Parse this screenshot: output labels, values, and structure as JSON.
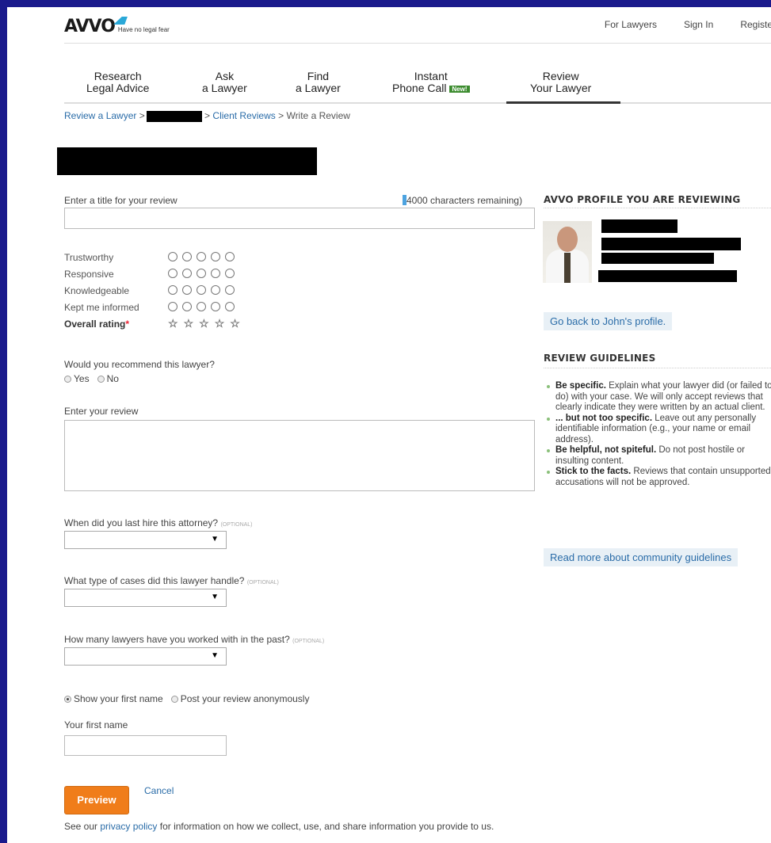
{
  "header": {
    "logo_text": "AVVO",
    "tagline": "Have no legal fear",
    "links": [
      "For Lawyers",
      "Sign In",
      "Register"
    ]
  },
  "nav": {
    "items": [
      {
        "line1": "Research",
        "line2": "Legal Advice"
      },
      {
        "line1": "Ask",
        "line2": "a Lawyer"
      },
      {
        "line1": "Find",
        "line2": "a Lawyer"
      },
      {
        "line1": "Instant",
        "line2": "Phone Call",
        "badge": "New!"
      },
      {
        "line1": "Review",
        "line2": "Your Lawyer"
      }
    ]
  },
  "breadcrumb": {
    "review_link": "Review a Lawyer",
    "sep1": " >",
    "client_reviews": "Client Reviews",
    "write": "Write a Review",
    "sep": " > "
  },
  "form": {
    "title_label": "Enter a title for your review",
    "chars_remaining": "4000 characters remaining)",
    "ratings": [
      "Trustworthy",
      "Responsive",
      "Knowledgeable",
      "Kept me informed"
    ],
    "overall_label": "Overall rating",
    "required_mark": "*",
    "recommend_label": "Would you recommend this lawyer?",
    "yes": "Yes",
    "no": "No",
    "review_label": "Enter your review",
    "hire_label": "When did you last hire this attorney?",
    "cases_label": "What type of cases did this lawyer handle?",
    "lawyers_label": "How many lawyers have you worked with in the past?",
    "optional": "(OPTIONAL)",
    "dropdown_arrow": "▼",
    "show_name": "Show your first name",
    "anonymous": "Post your review anonymously",
    "first_name_label": "Your first name",
    "preview_button": "Preview",
    "cancel": "Cancel",
    "privacy_pre": "See our ",
    "privacy_link": "privacy policy",
    "privacy_post": " for information on how we collect, use, and share information you provide to us."
  },
  "sidebar": {
    "profile_heading": "AVVO PROFILE YOU ARE REVIEWING",
    "back_link": "Go back to John's profile.",
    "guidelines_heading": "REVIEW GUIDELINES",
    "guidelines": [
      {
        "bold": "Be specific.",
        "text": " Explain what your lawyer did (or failed to do) with your case. We will only accept reviews that clearly indicate they were written by an actual client."
      },
      {
        "bold": "... but not too specific.",
        "text": " Leave out any personally identifiable information (e.g., your name or email address)."
      },
      {
        "bold": "Be helpful, not spiteful.",
        "text": " Do not post hostile or insulting content."
      },
      {
        "bold": "Stick to the facts.",
        "text": " Reviews that contain unsupported accusations will not be approved."
      }
    ],
    "community_link": "Read more about community guidelines"
  },
  "icons": {
    "star": "☆",
    "logo_mark": "avvo-flag-icon"
  }
}
